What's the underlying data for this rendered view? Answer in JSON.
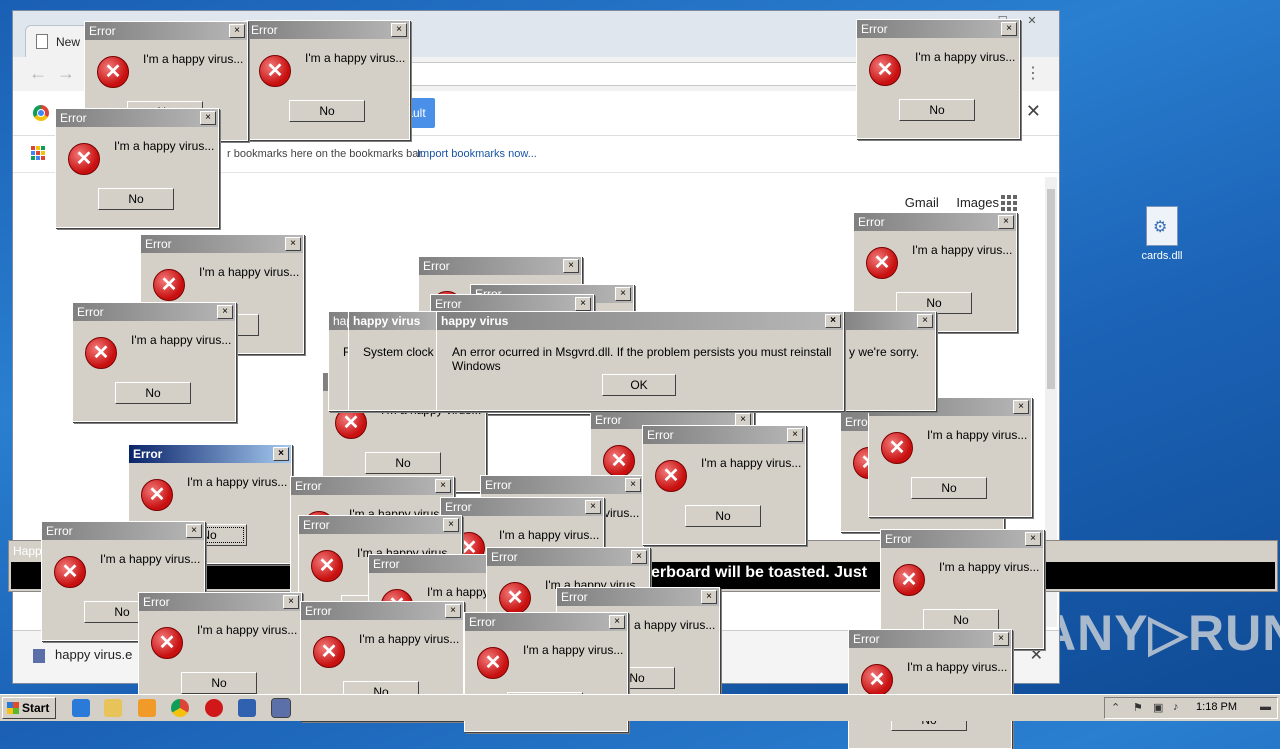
{
  "desktop": {
    "icon_label": "cards.dll",
    "watermark": "ANY▷RUN"
  },
  "browser": {
    "tab_title": "New",
    "omnibox_text": "e",
    "infobar_button": "Set as default",
    "bookmarks_text": "r bookmarks here on the bookmarks bar.",
    "bookmarks_link": "Import bookmarks now...",
    "gbar": {
      "gmail": "Gmail",
      "images": "Images"
    },
    "download_item": "happy virus.e"
  },
  "marquee": {
    "title": "Happ",
    "text": "erboard will be toasted. Just"
  },
  "dialogs": {
    "title": "Error",
    "message": "I'm a happy virus...",
    "button": "No",
    "close": "×"
  },
  "big_dialog": {
    "title": "happy virus",
    "message": "An error ocurred in Msgvrd.dll. If the problem persists you must reinstall Windows",
    "button": "OK",
    "left_title": "happy virus",
    "left_message": "System clock",
    "left_title_short": "hap",
    "left_message_short": "F",
    "right_message": "y we're sorry."
  },
  "taskbar": {
    "start_label": "Start",
    "clock": "1:18 PM",
    "apps": [
      "ie-icon",
      "folder-icon",
      "media-icon",
      "chrome-icon",
      "stop-icon",
      "app-icon",
      "virus-app-icon"
    ]
  },
  "colors": {
    "accent": "#4a90e8",
    "error_red": "#c81010"
  }
}
